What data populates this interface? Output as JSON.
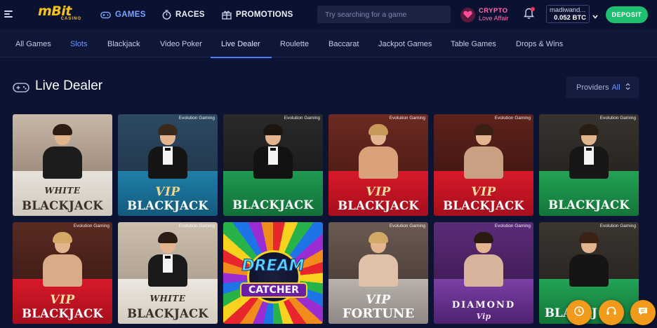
{
  "header": {
    "logo_text": "mBit",
    "logo_tag": "CASINO",
    "nav": [
      {
        "label": "GAMES",
        "icon": "gamepad-icon"
      },
      {
        "label": "RACES",
        "icon": "stopwatch-icon"
      },
      {
        "label": "PROMOTIONS",
        "icon": "gift-icon"
      }
    ],
    "search_placeholder": "Try searching for a game",
    "crypto_line1": "CRYPTO",
    "crypto_line2": "Love Affair",
    "username": "madiwand...",
    "balance": "0.052 BTC",
    "deposit_label": "DEPOSIT"
  },
  "categories": [
    {
      "label": "All Games"
    },
    {
      "label": "Slots"
    },
    {
      "label": "Blackjack"
    },
    {
      "label": "Video Poker"
    },
    {
      "label": "Live Dealer"
    },
    {
      "label": "Roulette"
    },
    {
      "label": "Baccarat"
    },
    {
      "label": "Jackpot Games"
    },
    {
      "label": "Table Games"
    },
    {
      "label": "Drops & Wins"
    }
  ],
  "active_category": "Live Dealer",
  "section": {
    "title": "Live Dealer",
    "providers_label": "Providers",
    "providers_value": "All"
  },
  "games": [
    {
      "line1": "WHITE",
      "line2": "BLACKJACK",
      "provider": ""
    },
    {
      "line1": "VIP",
      "line2": "BLACKJACK",
      "provider": "Evolution Gaming"
    },
    {
      "line1": "",
      "line2": "BLACKJACK",
      "provider": "Evolution Gaming"
    },
    {
      "line1": "VIP",
      "line2": "BLACKJACK",
      "provider": "Evolution Gaming"
    },
    {
      "line1": "VIP",
      "line2": "BLACKJACK",
      "provider": "Evolution Gaming"
    },
    {
      "line1": "",
      "line2": "BLACKJACK",
      "provider": "Evolution Gaming"
    },
    {
      "line1": "VIP",
      "line2": "BLACKJACK",
      "provider": "Evolution Gaming"
    },
    {
      "line1": "WHITE",
      "line2": "BLACKJACK",
      "provider": "Evolution Gaming"
    },
    {
      "line1": "DREAM",
      "line2": "CATCHER",
      "provider": ""
    },
    {
      "line1": "VIP",
      "line2": "FORTUNE",
      "provider": "Evolution Gaming"
    },
    {
      "line1": "DIAMOND",
      "line2": "Vip",
      "provider": "Evolution Gaming"
    },
    {
      "line1": "",
      "line2": "BLACKJ",
      "provider": "Evolution Gaming"
    }
  ],
  "colors": {
    "background": "#0d1433",
    "accent_blue": "#4d7cff",
    "deposit_green": "#1fbf72",
    "fab_orange": "#f29a1c",
    "crypto_pink": "#ff6fb0"
  }
}
